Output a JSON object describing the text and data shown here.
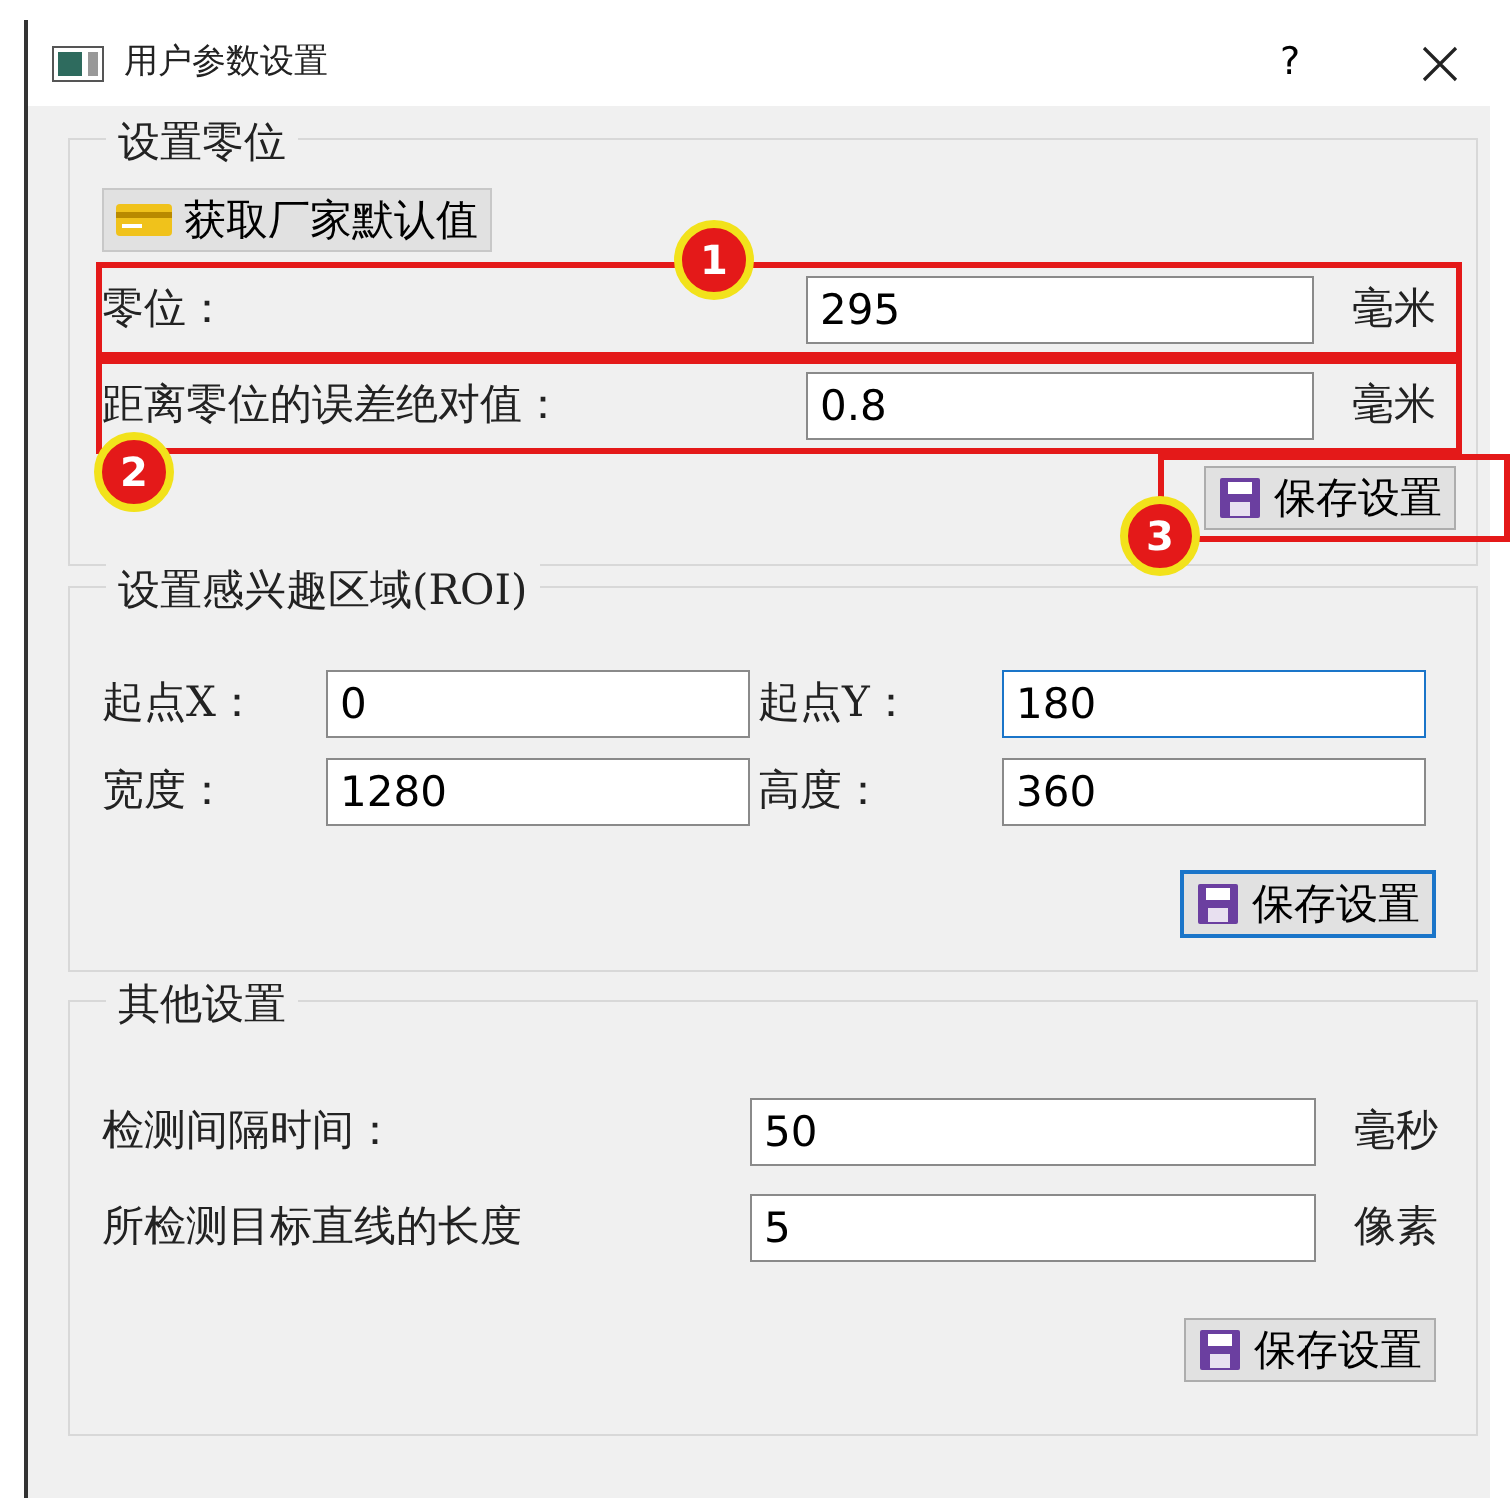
{
  "window": {
    "title": "用户参数设置",
    "help_button": "?"
  },
  "groups": [
    {
      "title": "设置零位",
      "top_button": {
        "label": "获取厂家默认值"
      },
      "kind": "unit_rows",
      "rows": [
        {
          "label": "零位：",
          "value": "295",
          "unit": "毫米",
          "highlighted": true,
          "callout": "1"
        },
        {
          "label": "距离零位的误差绝对值：",
          "value": "0.8",
          "unit": "毫米",
          "highlighted": true,
          "callout": "2"
        }
      ],
      "save_button": {
        "label": "保存设置",
        "default": false,
        "highlighted": true,
        "callout": "3"
      }
    },
    {
      "title": "设置感兴趣区域(ROI)",
      "kind": "pairs",
      "rows": [
        {
          "label": "起点X：",
          "value": "0",
          "focused": false
        },
        {
          "label": "起点Y：",
          "value": "180",
          "focused": true
        },
        {
          "label": "宽度：",
          "value": "1280",
          "focused": false
        },
        {
          "label": "高度：",
          "value": "360",
          "focused": false
        }
      ],
      "save_button": {
        "label": "保存设置",
        "default": true,
        "highlighted": false
      }
    },
    {
      "title": "其他设置",
      "kind": "unit_rows",
      "rows": [
        {
          "label": "检测间隔时间：",
          "value": "50",
          "unit": "毫秒",
          "highlighted": false
        },
        {
          "label": "所检测目标直线的长度",
          "value": "5",
          "unit": "像素",
          "highlighted": false
        }
      ],
      "save_button": {
        "label": "保存设置",
        "default": false,
        "highlighted": false
      }
    }
  ]
}
